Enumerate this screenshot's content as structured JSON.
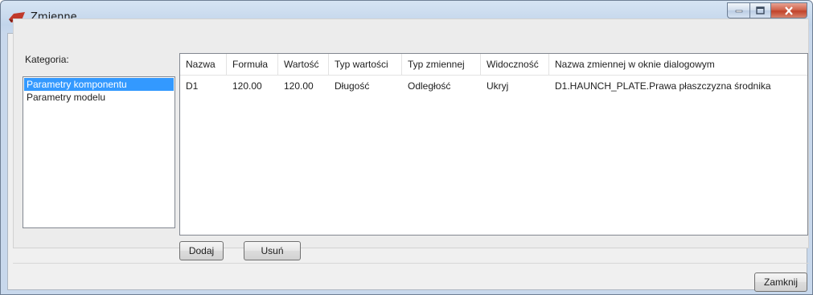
{
  "window": {
    "title": "Zmienne",
    "controls": [
      "minimize",
      "maximize",
      "close"
    ]
  },
  "category": {
    "label": "Kategoria:",
    "items": [
      {
        "label": "Parametry komponentu",
        "selected": true
      },
      {
        "label": "Parametry modelu",
        "selected": false
      }
    ]
  },
  "table": {
    "columns": [
      "Nazwa",
      "Formuła",
      "Wartość",
      "Typ wartości",
      "Typ zmiennej",
      "Widoczność",
      "Nazwa zmiennej w oknie dialogowym"
    ],
    "rows": [
      [
        "D1",
        "120.00",
        "120.00",
        "Długość",
        "Odległość",
        "Ukryj",
        "D1.HAUNCH_PLATE.Prawa płaszczyzna środnika"
      ]
    ]
  },
  "buttons": {
    "add": "Dodaj",
    "remove": "Usuń",
    "close": "Zamknij"
  },
  "colors": {
    "selection": "#3399ff",
    "title_bar": "#c8d8ec",
    "close_button": "#c1432a",
    "app_icon": "#c0392b"
  },
  "icons": {
    "app": "tekla-app-icon",
    "minimize": "minimize-icon",
    "maximize": "maximize-icon",
    "close": "close-icon"
  }
}
